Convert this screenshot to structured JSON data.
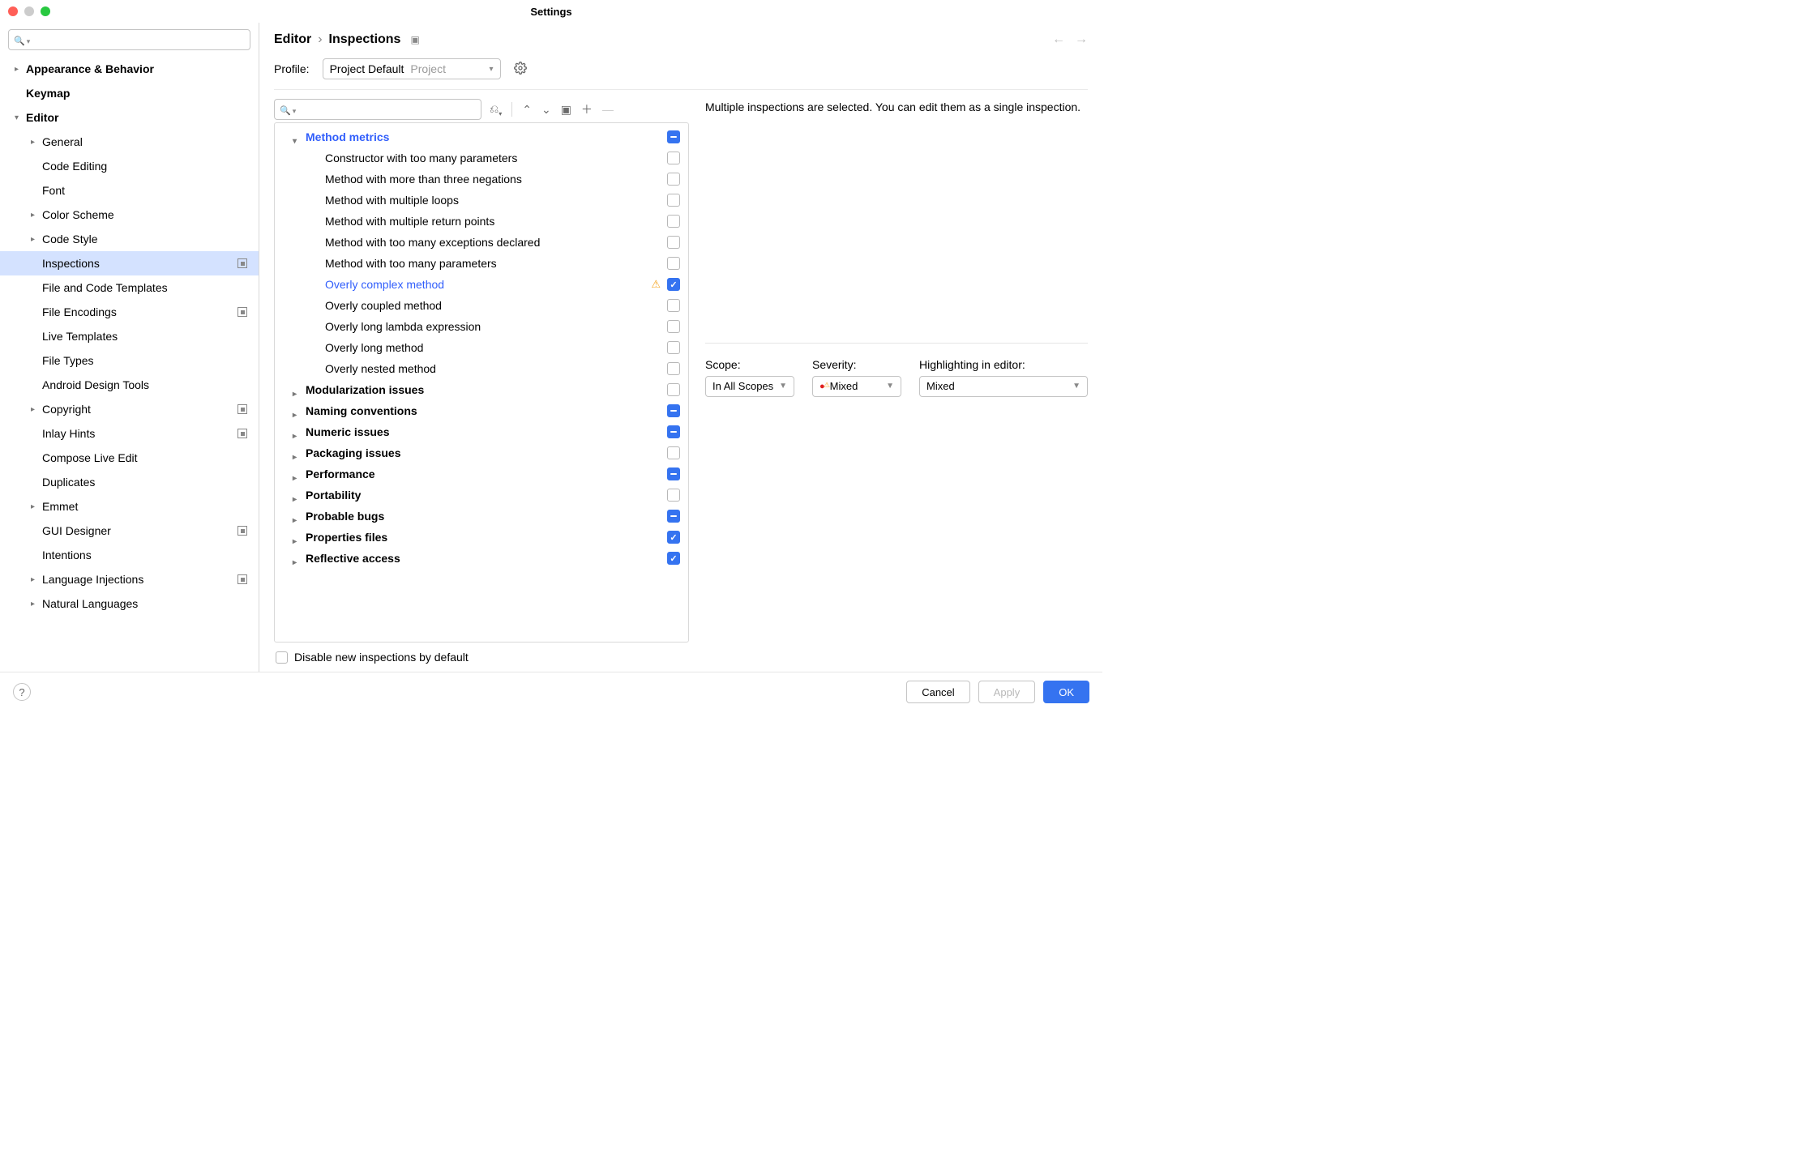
{
  "window": {
    "title": "Settings"
  },
  "sidebar": {
    "search_placeholder": "",
    "items": [
      {
        "label": "Appearance & Behavior",
        "expandable": true,
        "bold": true
      },
      {
        "label": "Keymap",
        "bold": true
      },
      {
        "label": "Editor",
        "expandable": true,
        "expanded": true,
        "bold": true
      },
      {
        "label": "General",
        "level": 1,
        "expandable": true
      },
      {
        "label": "Code Editing",
        "level": 1
      },
      {
        "label": "Font",
        "level": 1
      },
      {
        "label": "Color Scheme",
        "level": 1,
        "expandable": true
      },
      {
        "label": "Code Style",
        "level": 1,
        "expandable": true
      },
      {
        "label": "Inspections",
        "level": 1,
        "selected": true,
        "badge": true
      },
      {
        "label": "File and Code Templates",
        "level": 1
      },
      {
        "label": "File Encodings",
        "level": 1,
        "badge": true
      },
      {
        "label": "Live Templates",
        "level": 1
      },
      {
        "label": "File Types",
        "level": 1
      },
      {
        "label": "Android Design Tools",
        "level": 1
      },
      {
        "label": "Copyright",
        "level": 1,
        "expandable": true,
        "badge": true
      },
      {
        "label": "Inlay Hints",
        "level": 1,
        "badge": true
      },
      {
        "label": "Compose Live Edit",
        "level": 1
      },
      {
        "label": "Duplicates",
        "level": 1
      },
      {
        "label": "Emmet",
        "level": 1,
        "expandable": true
      },
      {
        "label": "GUI Designer",
        "level": 1,
        "badge": true
      },
      {
        "label": "Intentions",
        "level": 1
      },
      {
        "label": "Language Injections",
        "level": 1,
        "expandable": true,
        "badge": true
      },
      {
        "label": "Natural Languages",
        "level": 1,
        "expandable": true
      }
    ]
  },
  "breadcrumb": {
    "root": "Editor",
    "leaf": "Inspections"
  },
  "profile": {
    "label": "Profile:",
    "name": "Project Default",
    "scope": "Project"
  },
  "inspections": {
    "search_placeholder": "",
    "groups": [
      {
        "label": "Method metrics",
        "expanded": true,
        "highlight": true,
        "state": "mixed",
        "children": [
          {
            "label": "Constructor with too many parameters",
            "state": "unchecked"
          },
          {
            "label": "Method with more than three negations",
            "state": "unchecked"
          },
          {
            "label": "Method with multiple loops",
            "state": "unchecked"
          },
          {
            "label": "Method with multiple return points",
            "state": "unchecked"
          },
          {
            "label": "Method with too many exceptions declared",
            "state": "unchecked"
          },
          {
            "label": "Method with too many parameters",
            "state": "unchecked"
          },
          {
            "label": "Overly complex method",
            "state": "checked",
            "highlight": true,
            "warn": true
          },
          {
            "label": "Overly coupled method",
            "state": "unchecked"
          },
          {
            "label": "Overly long lambda expression",
            "state": "unchecked"
          },
          {
            "label": "Overly long method",
            "state": "unchecked"
          },
          {
            "label": "Overly nested method",
            "state": "unchecked"
          }
        ]
      },
      {
        "label": "Modularization issues",
        "state": "unchecked"
      },
      {
        "label": "Naming conventions",
        "state": "mixed"
      },
      {
        "label": "Numeric issues",
        "state": "mixed"
      },
      {
        "label": "Packaging issues",
        "state": "unchecked"
      },
      {
        "label": "Performance",
        "state": "mixed"
      },
      {
        "label": "Portability",
        "state": "unchecked"
      },
      {
        "label": "Probable bugs",
        "state": "mixed"
      },
      {
        "label": "Properties files",
        "state": "checked"
      },
      {
        "label": "Reflective access",
        "state": "checked"
      }
    ],
    "disable_label": "Disable new inspections by default"
  },
  "detail": {
    "info": "Multiple inspections are selected. You can edit them as a single inspection.",
    "scope_label": "Scope:",
    "scope_value": "In All Scopes",
    "severity_label": "Severity:",
    "severity_value": "Mixed",
    "highlight_label": "Highlighting in editor:",
    "highlight_value": "Mixed"
  },
  "footer": {
    "cancel": "Cancel",
    "apply": "Apply",
    "ok": "OK"
  }
}
